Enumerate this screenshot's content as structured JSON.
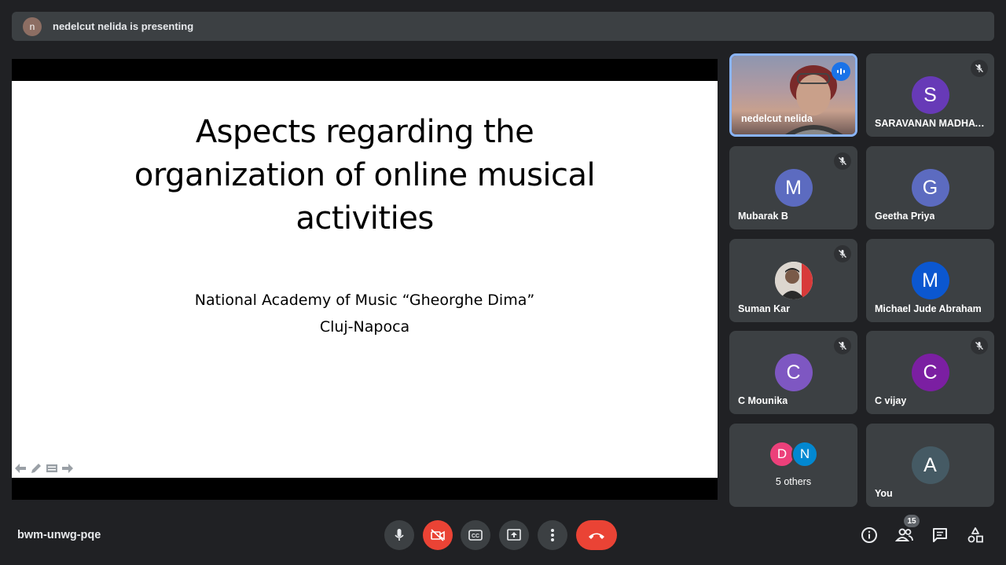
{
  "banner": {
    "initial": "n",
    "text": "nedelcut nelida is presenting"
  },
  "slide": {
    "title_line1": "Aspects regarding the",
    "title_line2": "organization of online musical",
    "title_line3": "activities",
    "subtitle_line1": "National Academy of Music “Gheorghe Dima”",
    "subtitle_line2": "Cluj-Napoca"
  },
  "participants": [
    {
      "name": "nedelcut nelida",
      "initial": "",
      "color": "",
      "muted": false,
      "speaking": true
    },
    {
      "name": "SARAVANAN MADHAVAN",
      "initial": "S",
      "color": "#673ab7",
      "muted": true
    },
    {
      "name": "Mubarak B",
      "initial": "M",
      "color": "#5c6bc0",
      "muted": true
    },
    {
      "name": "Geetha Priya",
      "initial": "G",
      "color": "#5c6bc0",
      "muted": false
    },
    {
      "name": "Suman Kar",
      "initial": "",
      "color": "",
      "muted": true
    },
    {
      "name": "Michael Jude Abraham",
      "initial": "M",
      "color": "#0b57d0",
      "muted": false
    },
    {
      "name": "C Mounika",
      "initial": "C",
      "color": "#7e57c2",
      "muted": true
    },
    {
      "name": "C vijay",
      "initial": "C",
      "color": "#7b1fa2",
      "muted": true
    },
    {
      "name": "You",
      "initial": "A",
      "color": "#455a64",
      "muted": false
    }
  ],
  "others": {
    "initial_1": "D",
    "color_1": "#ec407a",
    "initial_2": "N",
    "color_2": "#0288d1",
    "label": "5 others"
  },
  "bottom": {
    "meeting_code": "bwm-unwg-pqe",
    "participant_count": "15"
  },
  "colors": {
    "end_call": "#ea4335",
    "speaking_border": "#8ab4f8",
    "tile_bg": "#3c4043"
  }
}
